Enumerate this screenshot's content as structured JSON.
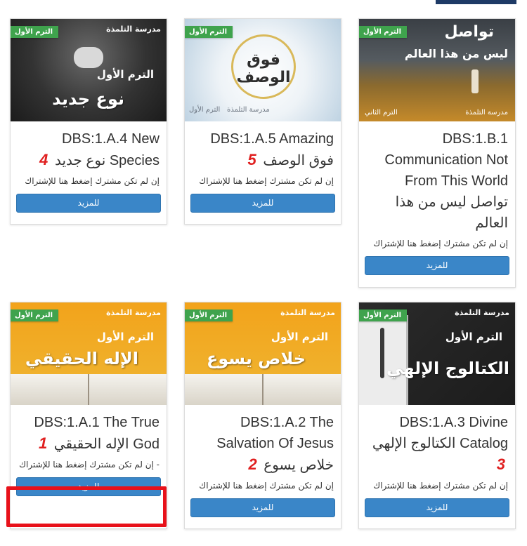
{
  "cards": [
    {
      "ribbon": "الترم الأول",
      "school": "مدرسة التلمذة",
      "image_term": "الترم الأول",
      "image_title": "نوع جديد",
      "title_en": "DBS:1.A.4 New Species",
      "title_ar": "نوع جديد",
      "number": "4",
      "subscribe_text": "إن لم تكن مشترك إضغط هنا للإشتراك",
      "button": "للمزيد"
    },
    {
      "ribbon": "الترم الأول",
      "school": "مدرسة التلمذة",
      "image_term": "الترم الأول",
      "image_title": "فوق الوصف",
      "title_en": "DBS:1.A.5 Amazing",
      "title_ar": "فوق الوصف",
      "number": "5",
      "subscribe_text": "إن لم تكن مشترك إضغط هنا للإشتراك",
      "button": "للمزيد"
    },
    {
      "ribbon": "الترم الأول",
      "school": "مدرسة التلمذة",
      "image_term": "الترم الثاني",
      "image_title": "تواصل",
      "image_subtitle": "ليس من هذا العالم",
      "title_en": "DBS:1.B.1 Communication Not From This World",
      "title_ar": "تواصل ليس من هذا العالم",
      "subscribe_text": "إن لم تكن مشترك إضغط هنا للإشتراك",
      "button": "للمزيد"
    },
    {
      "ribbon": "الترم الأول",
      "school": "مدرسة التلمذة",
      "image_term": "الترم الأول",
      "image_title": "الإله الحقيقي",
      "title_en": "DBS:1.A.1 The True God",
      "title_ar": "الإله الحقيقي",
      "number": "1",
      "subscribe_text": "- إن لم تكن مشترك إضغط هنا للإشتراك",
      "button": "للمزيد"
    },
    {
      "ribbon": "الترم الأول",
      "school": "مدرسة التلمذة",
      "image_term": "الترم الأول",
      "image_title": "خلاص يسوع",
      "title_en": "DBS:1.A.2 The Salvation Of Jesus",
      "title_ar": "خلاص يسوع",
      "number": "2",
      "subscribe_text": "إن لم تكن مشترك إضغط هنا للإشتراك",
      "button": "للمزيد"
    },
    {
      "ribbon": "الترم الأول",
      "school": "مدرسة التلمذة",
      "image_term": "الترم الأول",
      "image_title": "الكتالوج الإلهي",
      "title_en": "DBS:1.A.3 Divine Catalog",
      "title_ar": "الكتالوج الإلهي",
      "number": "3",
      "subscribe_text": "إن لم تكن مشترك إضغط هنا للإشتراك",
      "button": "للمزيد"
    }
  ],
  "colors": {
    "ribbon": "#3fa34d",
    "button": "#3a86c8",
    "highlight": "#e8111a",
    "number": "#e02020"
  }
}
